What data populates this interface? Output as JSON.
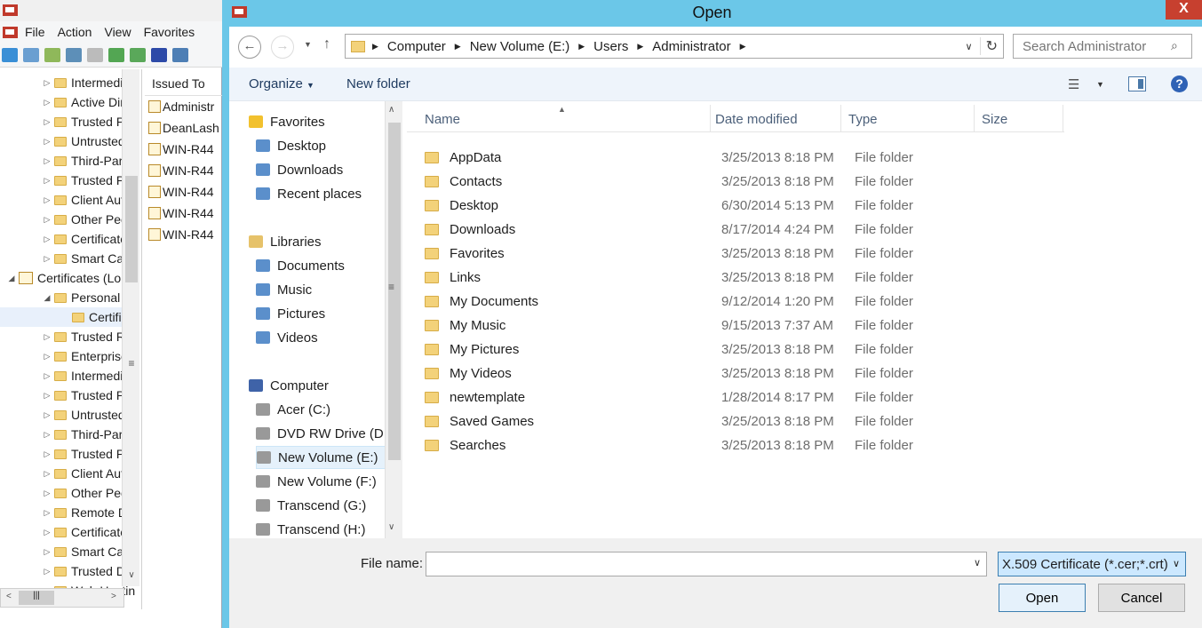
{
  "mmc": {
    "menu": [
      "File",
      "Action",
      "View",
      "Favorites"
    ],
    "tree": [
      {
        "label": "Intermediat",
        "indent": 1
      },
      {
        "label": "Active Direc",
        "indent": 1
      },
      {
        "label": "Trusted Pub",
        "indent": 1
      },
      {
        "label": "Untrusted C",
        "indent": 1
      },
      {
        "label": "Third-Party",
        "indent": 1
      },
      {
        "label": "Trusted Peo",
        "indent": 1
      },
      {
        "label": "Client Auth",
        "indent": 1
      },
      {
        "label": "Other Peop",
        "indent": 1
      },
      {
        "label": "Certificate E",
        "indent": 1
      },
      {
        "label": "Smart Card",
        "indent": 1
      },
      {
        "label": "Certificates (Lo",
        "indent": 0
      },
      {
        "label": "Personal",
        "indent": 1
      },
      {
        "label": "Certifica",
        "indent": 2
      },
      {
        "label": "Trusted Roo",
        "indent": 1
      },
      {
        "label": "Enterprise T",
        "indent": 1
      },
      {
        "label": "Intermediat",
        "indent": 1
      },
      {
        "label": "Trusted Pub",
        "indent": 1
      },
      {
        "label": "Untrusted C",
        "indent": 1
      },
      {
        "label": "Third-Party",
        "indent": 1
      },
      {
        "label": "Trusted Peo",
        "indent": 1
      },
      {
        "label": "Client Auth",
        "indent": 1
      },
      {
        "label": "Other Peop",
        "indent": 1
      },
      {
        "label": "Remote De",
        "indent": 1
      },
      {
        "label": "Certificate E",
        "indent": 1
      },
      {
        "label": "Smart Card",
        "indent": 1
      },
      {
        "label": "Trusted Dev",
        "indent": 1
      },
      {
        "label": "Web Hostin",
        "indent": 1
      }
    ],
    "list_header": "Issued To",
    "list": [
      "Administr",
      "DeanLash",
      "WIN-R44",
      "WIN-R44",
      "WIN-R44",
      "WIN-R44",
      "WIN-R44"
    ]
  },
  "dialog": {
    "title": "Open",
    "close": "X",
    "breadcrumb": [
      "Computer",
      "New Volume (E:)",
      "Users",
      "Administrator"
    ],
    "search_placeholder": "Search Administrator",
    "organize": "Organize",
    "new_folder": "New folder",
    "nav": {
      "favorites": "Favorites",
      "favorites_items": [
        "Desktop",
        "Downloads",
        "Recent places"
      ],
      "libraries": "Libraries",
      "libraries_items": [
        "Documents",
        "Music",
        "Pictures",
        "Videos"
      ],
      "computer": "Computer",
      "computer_items": [
        "Acer (C:)",
        "DVD RW Drive (D",
        "New Volume (E:)",
        "New Volume (F:)",
        "Transcend (G:)",
        "Transcend (H:)"
      ],
      "selected_drive": "New Volume (E:)"
    },
    "columns": [
      "Name",
      "Date modified",
      "Type",
      "Size"
    ],
    "files": [
      {
        "name": "AppData",
        "date": "3/25/2013 8:18 PM",
        "type": "File folder"
      },
      {
        "name": "Contacts",
        "date": "3/25/2013 8:18 PM",
        "type": "File folder"
      },
      {
        "name": "Desktop",
        "date": "6/30/2014 5:13 PM",
        "type": "File folder"
      },
      {
        "name": "Downloads",
        "date": "8/17/2014 4:24 PM",
        "type": "File folder"
      },
      {
        "name": "Favorites",
        "date": "3/25/2013 8:18 PM",
        "type": "File folder"
      },
      {
        "name": "Links",
        "date": "3/25/2013 8:18 PM",
        "type": "File folder"
      },
      {
        "name": "My Documents",
        "date": "9/12/2014 1:20 PM",
        "type": "File folder"
      },
      {
        "name": "My Music",
        "date": "9/15/2013 7:37 AM",
        "type": "File folder"
      },
      {
        "name": "My Pictures",
        "date": "3/25/2013 8:18 PM",
        "type": "File folder"
      },
      {
        "name": "My Videos",
        "date": "3/25/2013 8:18 PM",
        "type": "File folder"
      },
      {
        "name": "newtemplate",
        "date": "1/28/2014 8:17 PM",
        "type": "File folder"
      },
      {
        "name": "Saved Games",
        "date": "3/25/2013 8:18 PM",
        "type": "File folder"
      },
      {
        "name": "Searches",
        "date": "3/25/2013 8:18 PM",
        "type": "File folder"
      }
    ],
    "file_name_label": "File name:",
    "file_name_value": "",
    "filter": "X.509 Certificate (*.cer;*.crt)",
    "open_button": "Open",
    "cancel_button": "Cancel"
  }
}
